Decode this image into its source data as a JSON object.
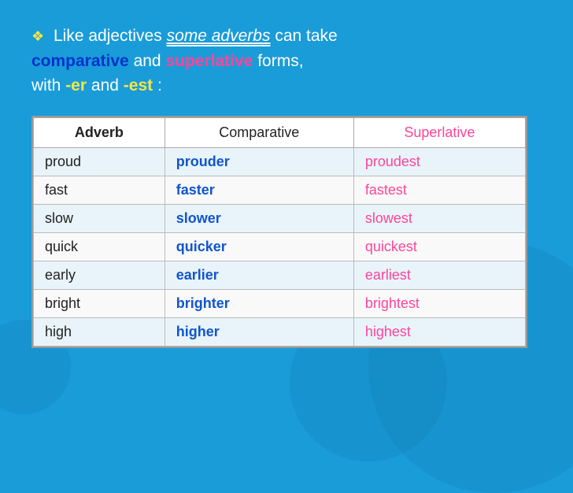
{
  "intro": {
    "diamond": "❖",
    "text1": " Like adjectives ",
    "adverbs": "some adverbs",
    "text2": " can take ",
    "comparative": "comparative",
    "text3": " and ",
    "superlative": "superlative",
    "text4": " forms,",
    "text5": "with ",
    "er": "-er",
    "text6": " and ",
    "est": "-est",
    "text7": ":"
  },
  "table": {
    "headers": [
      "Adverb",
      "Comparative",
      "Superlative"
    ],
    "rows": [
      [
        "proud",
        "prouder",
        "proudest"
      ],
      [
        "fast",
        "faster",
        "fastest"
      ],
      [
        "slow",
        "slower",
        "slowest"
      ],
      [
        "quick",
        "quicker",
        "quickest"
      ],
      [
        "early",
        "earlier",
        "earliest"
      ],
      [
        "bright",
        "brighter",
        "brightest"
      ],
      [
        "high",
        "higher",
        "highest"
      ]
    ]
  }
}
